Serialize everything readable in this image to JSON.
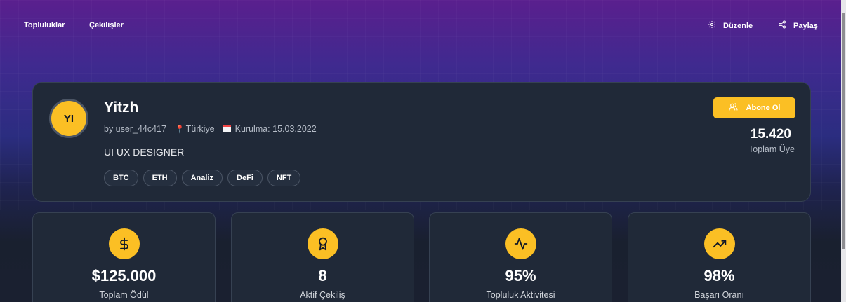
{
  "nav": {
    "communities": "Topluluklar",
    "giveaways": "Çekilişler",
    "edit": "Düzenle",
    "share": "Paylaş"
  },
  "profile": {
    "initials": "YI",
    "name": "Yitzh",
    "by": "by user_44c417",
    "location": "Türkiye",
    "founded": "Kurulma: 15.03.2022",
    "bio": "UI UX DESIGNER",
    "tags": [
      "BTC",
      "ETH",
      "Analiz",
      "DeFi",
      "NFT"
    ],
    "subscribe_label": "Abone Ol",
    "members_value": "15.420",
    "members_label": "Toplam Üye"
  },
  "stats": [
    {
      "icon": "dollar-icon",
      "value": "$125.000",
      "label": "Toplam Ödül"
    },
    {
      "icon": "award-icon",
      "value": "8",
      "label": "Aktif Çekiliş"
    },
    {
      "icon": "activity-icon",
      "value": "95%",
      "label": "Topluluk Aktivitesi"
    },
    {
      "icon": "trending-up-icon",
      "value": "98%",
      "label": "Başarı Oranı"
    }
  ],
  "colors": {
    "accent": "#fbbf24",
    "card_bg": "#202938",
    "card_border": "#364152",
    "gradient_top": "#5a1f8e",
    "gradient_bottom": "#1a2030"
  }
}
